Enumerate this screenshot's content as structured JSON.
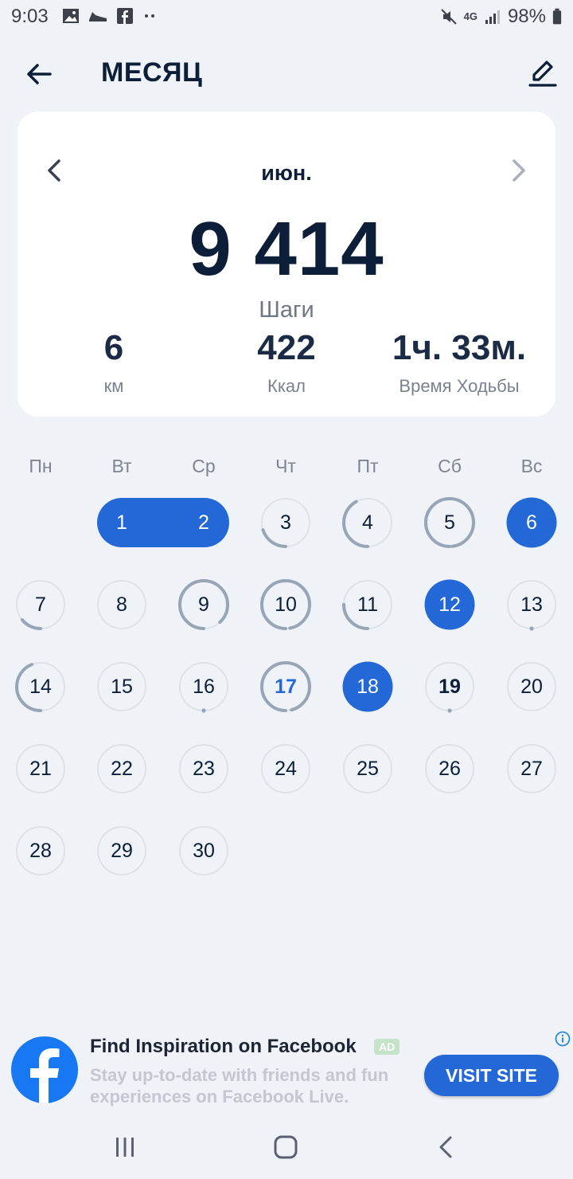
{
  "status_bar": {
    "time": "9:03",
    "network": "4G",
    "battery": "98%"
  },
  "header": {
    "title": "МЕСЯЦ"
  },
  "summary": {
    "month": "июн.",
    "steps_value": "9 414",
    "steps_label": "Шаги",
    "distance_value": "6",
    "distance_label": "км",
    "calories_value": "422",
    "calories_label": "Ккал",
    "time_value": "1ч. 33м.",
    "time_label": "Время Ходьбы"
  },
  "calendar": {
    "weekdays": [
      "Пн",
      "Вт",
      "Ср",
      "Чт",
      "Пт",
      "Сб",
      "Вс"
    ],
    "first_weekday_index": 1,
    "days_in_month": 30,
    "selected_range": [
      1,
      2
    ],
    "today": 17,
    "days": [
      {
        "day": 1,
        "progress": 1.0,
        "state": "goal"
      },
      {
        "day": 2,
        "progress": 1.0,
        "state": "goal"
      },
      {
        "day": 3,
        "progress": 0.2,
        "state": "partial"
      },
      {
        "day": 4,
        "progress": 0.42,
        "state": "partial"
      },
      {
        "day": 5,
        "progress": 0.98,
        "state": "partial"
      },
      {
        "day": 6,
        "progress": 1.0,
        "state": "goal"
      },
      {
        "day": 7,
        "progress": 0.14,
        "state": "partial"
      },
      {
        "day": 8,
        "progress": 0.0,
        "state": "none"
      },
      {
        "day": 9,
        "progress": 0.88,
        "state": "partial"
      },
      {
        "day": 10,
        "progress": 0.97,
        "state": "partial"
      },
      {
        "day": 11,
        "progress": 0.25,
        "state": "partial"
      },
      {
        "day": 12,
        "progress": 1.0,
        "state": "goal"
      },
      {
        "day": 13,
        "progress": 0.01,
        "state": "dot"
      },
      {
        "day": 14,
        "progress": 0.44,
        "state": "partial"
      },
      {
        "day": 15,
        "progress": 0.0,
        "state": "none"
      },
      {
        "day": 16,
        "progress": 0.01,
        "state": "dot"
      },
      {
        "day": 17,
        "progress": 0.96,
        "state": "today"
      },
      {
        "day": 18,
        "progress": 1.0,
        "state": "goal"
      },
      {
        "day": 19,
        "progress": 0.01,
        "state": "dot-bold"
      },
      {
        "day": 20,
        "progress": 0.0,
        "state": "none"
      },
      {
        "day": 21,
        "progress": 0.0,
        "state": "none"
      },
      {
        "day": 22,
        "progress": 0.0,
        "state": "none"
      },
      {
        "day": 23,
        "progress": 0.0,
        "state": "none"
      },
      {
        "day": 24,
        "progress": 0.0,
        "state": "none"
      },
      {
        "day": 25,
        "progress": 0.0,
        "state": "none"
      },
      {
        "day": 26,
        "progress": 0.0,
        "state": "none"
      },
      {
        "day": 27,
        "progress": 0.0,
        "state": "none"
      },
      {
        "day": 28,
        "progress": 0.0,
        "state": "none"
      },
      {
        "day": 29,
        "progress": 0.0,
        "state": "none"
      },
      {
        "day": 30,
        "progress": 0.0,
        "state": "none"
      }
    ]
  },
  "ad": {
    "title": "Find Inspiration on Facebook",
    "badge": "AD",
    "text": "Stay up-to-date with friends and fun experiences on Facebook Live.",
    "button_label": "VISIT SITE"
  },
  "colors": {
    "accent": "#2468d8",
    "ring": "#98a5b6",
    "ring_track": "#dde2e9",
    "text_dark": "#0d1f38",
    "background": "#eff2f7"
  },
  "icons": {
    "back": "arrow-left-icon",
    "edit": "pencil-icon",
    "prev": "chevron-left-icon",
    "next": "chevron-right-icon",
    "ad_logo": "facebook-logo-icon",
    "ad_info": "info-icon",
    "nav_recents": "recents-icon",
    "nav_home": "home-icon",
    "nav_back": "nav-back-icon"
  }
}
